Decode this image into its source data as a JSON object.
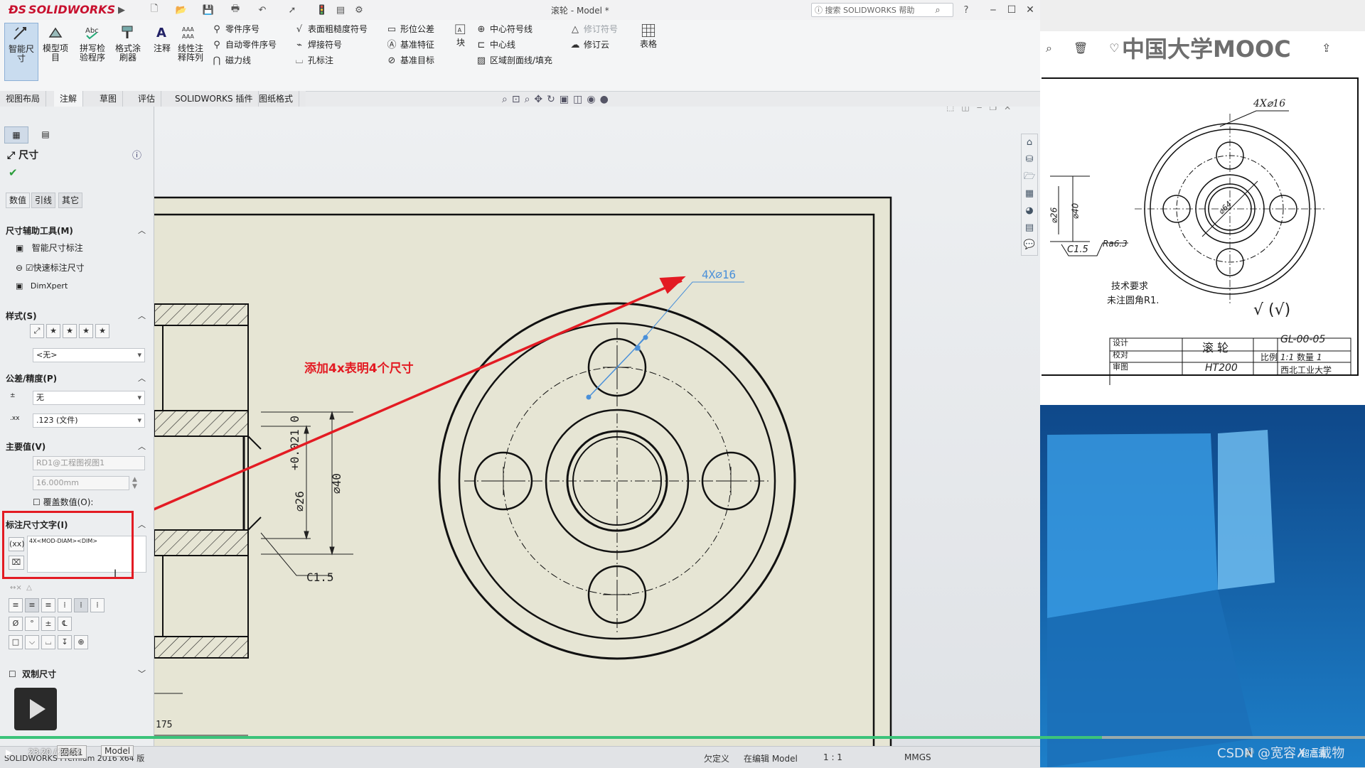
{
  "app": {
    "brand": "SOLIDWORKS",
    "document_title": "滚轮 - Model *",
    "help_search_placeholder": "搜索 SOLIDWORKS 帮助",
    "help_label": "?",
    "version_text": "SOLIDWORKS Premium 2016 x64 版"
  },
  "ribbon": {
    "big_buttons": [
      {
        "label": "智能尺寸",
        "icon": "smart-dimension-icon"
      },
      {
        "label": "模型项目",
        "icon": "model-items-icon"
      },
      {
        "label": "拼写检验程序",
        "icon": "spell-check-icon"
      },
      {
        "label": "格式涂刷器",
        "icon": "format-painter-icon"
      },
      {
        "label": "注释",
        "icon": "note-icon"
      },
      {
        "label": "线性注释阵列",
        "icon": "linear-note-pattern-icon"
      }
    ],
    "col1": [
      "零件序号",
      "自动零件序号",
      "磁力线"
    ],
    "col2": [
      "表面粗糙度符号",
      "焊接符号",
      "孔标注"
    ],
    "col3": [
      "形位公差",
      "基准特征",
      "基准目标"
    ],
    "block_label": "块",
    "col4": [
      "中心符号线",
      "中心线",
      "区域剖面线/填充"
    ],
    "col5": [
      "修订符号",
      "修订云"
    ],
    "table_label": "表格"
  },
  "tabs": [
    "视图布局",
    "注解",
    "草图",
    "评估",
    "SOLIDWORKS 插件",
    "图纸格式"
  ],
  "active_tab": 1,
  "property_manager": {
    "title": "尺寸",
    "help_icon": "help-icon",
    "confirm_icon": "check-icon",
    "subtabs": [
      "数值",
      "引线",
      "其它"
    ],
    "sections": {
      "dimension_assist": {
        "title": "尺寸辅助工具(M)",
        "items": [
          "智能尺寸标注",
          "快速标注尺寸",
          "DimXpert"
        ],
        "quick_dim_checked": true
      },
      "style": {
        "title": "样式(S)",
        "value": "<无>"
      },
      "tolerance": {
        "title": "公差/精度(P)",
        "tolerance_type": "无",
        "precision": ".123 (文件)"
      },
      "primary_value": {
        "title": "主要值(V)",
        "reference": "RD1@工程图视图1",
        "value": "16.000mm",
        "override_label": "覆盖数值(O):",
        "override_checked": false
      },
      "dimension_text": {
        "title": "标注尺寸文字(I)",
        "text": "4X<MOD-DIAM><DIM>"
      },
      "dual_dimension": {
        "title": "双制尺寸",
        "checked": false
      }
    }
  },
  "drawing": {
    "annotation_note": "添加4x表明4个尺寸",
    "hole_callout": "4X⌀16",
    "dim_tolerance": "+0.021 0",
    "dim_26": "⌀26",
    "dim_40": "⌀40",
    "chamfer": "C1.5",
    "dim_175": "175"
  },
  "statusbar": {
    "sheets": [
      "图纸1",
      "Model"
    ],
    "state_undefined": "欠定义",
    "editing": "在编辑 Model",
    "scale": "1 : 1",
    "units": "MMGS"
  },
  "video": {
    "time": "23:20 / 26:52",
    "time_left": "23:20",
    "time_total": "26:52",
    "quality": "超高清"
  },
  "reference_drawing": {
    "callout": "4X⌀16",
    "dim_26": "⌀26",
    "dim_40": "⌀40",
    "dim_64": "⌀64",
    "chamfer": "C1.5",
    "roughness": "Ra6.3",
    "tech_title": "技术要求",
    "tech_text": "未注圆角R1.",
    "title_block": {
      "part_name": "滚 轮",
      "drawing_no": "GL-00-05",
      "material": "HT200",
      "scale_label": "比例",
      "scale_value": "1:1",
      "qty_label": "数量",
      "qty_value": "1",
      "school": "西北工业大学",
      "rows": [
        "设计",
        "校对",
        "审图"
      ]
    }
  },
  "overlay": {
    "mooc_logo": "中国大学MOOC",
    "watermark": "CSDN @宽容✗  Ξ载物"
  },
  "colors": {
    "accent_red": "#e31b23",
    "dim_blue": "#4a90d9",
    "sheet": "#e8e8d6",
    "progress_green": "#3cc37a"
  }
}
